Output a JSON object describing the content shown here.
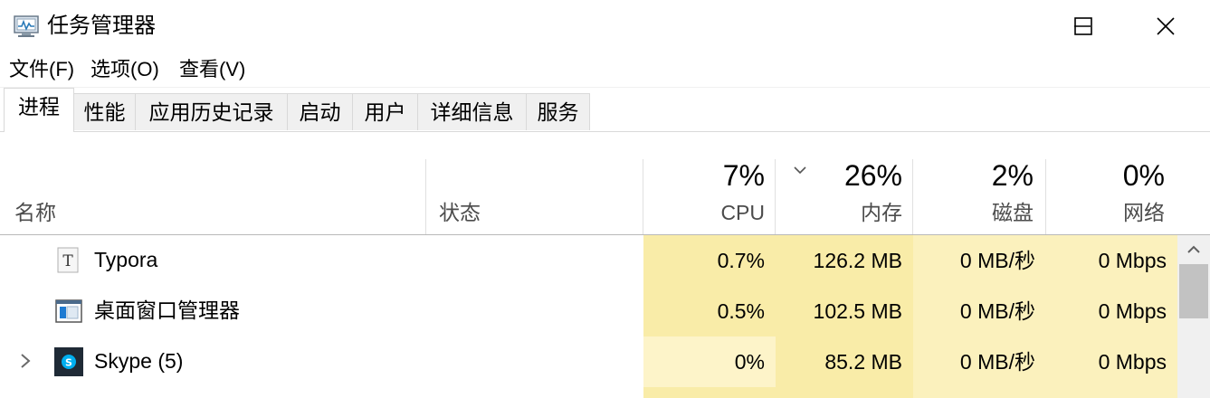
{
  "window": {
    "title": "任务管理器",
    "icons": {
      "app": "task-manager-icon",
      "minimize": "minimize-icon",
      "maximize": "maximize-icon",
      "close": "close-icon"
    }
  },
  "menu": {
    "file": "文件(F)",
    "options": "选项(O)",
    "view": "查看(V)"
  },
  "tabs": [
    "进程",
    "性能",
    "应用历史记录",
    "启动",
    "用户",
    "详细信息",
    "服务"
  ],
  "active_tab": "进程",
  "columns": {
    "name": "名称",
    "status": "状态",
    "cpu": {
      "label": "CPU",
      "percent": "7%"
    },
    "memory": {
      "label": "内存",
      "percent": "26%"
    },
    "disk": {
      "label": "磁盘",
      "percent": "2%"
    },
    "network": {
      "label": "网络",
      "percent": "0%"
    },
    "sorted_by": "memory"
  },
  "rows": [
    {
      "name": "Typora",
      "icon": "typora-icon",
      "expandable": false,
      "cpu": "0.7%",
      "memory": "126.2 MB",
      "disk": "0 MB/秒",
      "network": "0 Mbps"
    },
    {
      "name": "桌面窗口管理器",
      "icon": "desktop-window-manager-icon",
      "expandable": false,
      "cpu": "0.5%",
      "memory": "102.5 MB",
      "disk": "0 MB/秒",
      "network": "0 Mbps"
    },
    {
      "name": "Skype (5)",
      "icon": "skype-icon",
      "expandable": true,
      "cpu": "0%",
      "memory": "85.2 MB",
      "disk": "0 MB/秒",
      "network": "0 Mbps"
    }
  ],
  "colors": {
    "heat_strong": "#f9eca8",
    "heat_medium": "#fbf1bd",
    "heat_light": "#fdf4c9",
    "tab_inactive": "#f0f0f0",
    "skype_blue": "#00aff0"
  }
}
